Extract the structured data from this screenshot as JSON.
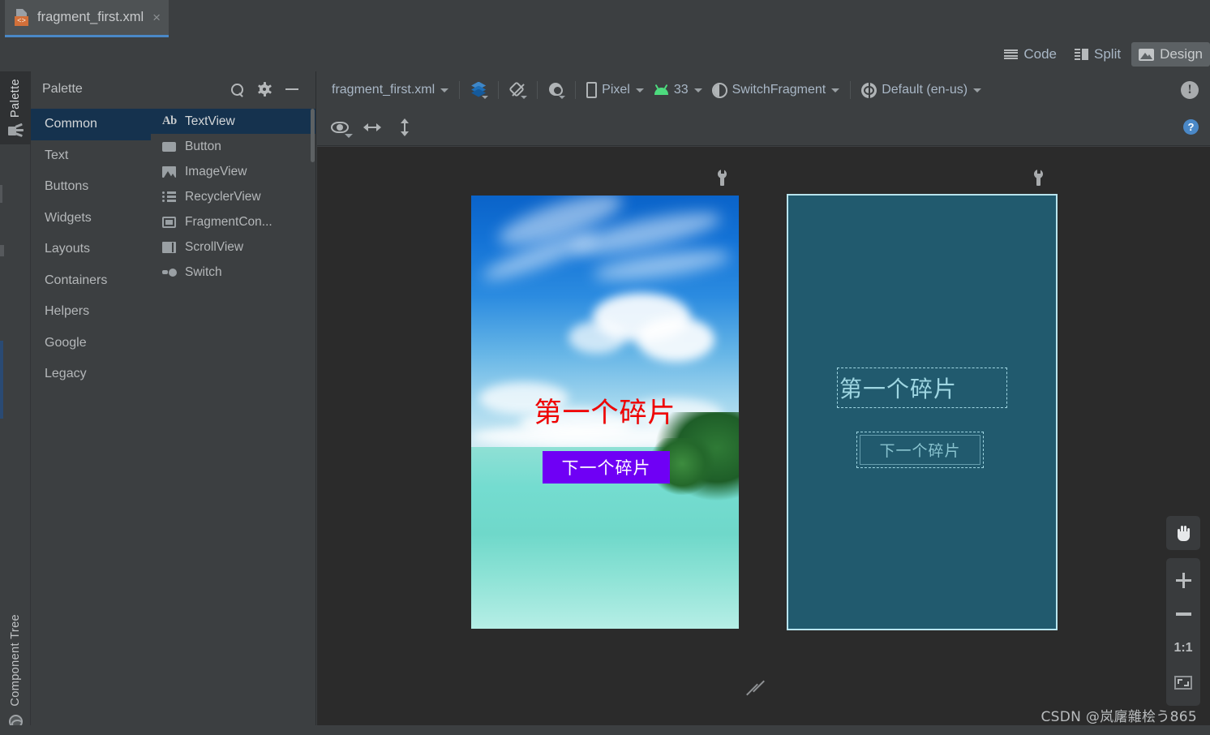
{
  "window": {
    "tab": {
      "label": "fragment_first.xml",
      "close": "×",
      "icon": "xml-file-icon",
      "code_glyph": "<>"
    }
  },
  "mode_switch": {
    "items": [
      {
        "label": "Code",
        "icon": "code-lines-icon",
        "active": false
      },
      {
        "label": "Split",
        "icon": "split-view-icon",
        "active": false
      },
      {
        "label": "Design",
        "icon": "design-image-icon",
        "active": true
      }
    ]
  },
  "left_strip": {
    "top_tab": {
      "label": "Palette",
      "icon": "palette-icon"
    },
    "bottom_tab": {
      "label": "Component Tree",
      "icon": "globe-icon"
    }
  },
  "palette": {
    "title": "Palette",
    "actions": [
      {
        "name": "search",
        "icon": "search-icon"
      },
      {
        "name": "settings",
        "icon": "gear-icon"
      },
      {
        "name": "collapse",
        "icon": "minus-icon"
      }
    ],
    "categories": [
      {
        "label": "Common",
        "selected": true
      },
      {
        "label": "Text",
        "selected": false
      },
      {
        "label": "Buttons",
        "selected": false
      },
      {
        "label": "Widgets",
        "selected": false
      },
      {
        "label": "Layouts",
        "selected": false
      },
      {
        "label": "Containers",
        "selected": false
      },
      {
        "label": "Helpers",
        "selected": false
      },
      {
        "label": "Google",
        "selected": false
      },
      {
        "label": "Legacy",
        "selected": false
      }
    ],
    "items": [
      {
        "label": "TextView",
        "icon": "ab-text-icon",
        "selected": true
      },
      {
        "label": "Button",
        "icon": "button-icon",
        "selected": false
      },
      {
        "label": "ImageView",
        "icon": "image-icon",
        "selected": false
      },
      {
        "label": "RecyclerView",
        "icon": "list-icon",
        "selected": false
      },
      {
        "label": "FragmentCon...",
        "icon": "fragment-container-icon",
        "selected": false
      },
      {
        "label": "ScrollView",
        "icon": "scrollview-icon",
        "selected": false
      },
      {
        "label": "Switch",
        "icon": "switch-icon",
        "selected": false
      }
    ]
  },
  "design_toolbar": {
    "file": "fragment_first.xml",
    "layout_variant_icon": "layers-icon",
    "orientation_icon": "rotate-device-icon",
    "theme_icon": "theme-contrast-icon",
    "device": "Pixel",
    "device_icon": "phone-icon",
    "api": "33",
    "api_icon": "android-icon",
    "theme": "SwitchFragment",
    "theme_sel_icon": "contrast-circle-icon",
    "locale": "Default (en-us)",
    "locale_icon": "globe-locale-icon",
    "issues_icon": "warning-icon"
  },
  "view_toolbar": {
    "visibility_icon": "eye-icon",
    "horizontal_icon": "horizontal-arrow-icon",
    "vertical_icon": "vertical-arrow-icon",
    "help_icon": "help-icon",
    "help_glyph": "?"
  },
  "canvas": {
    "design_preview": {
      "wrench_icon": "wrench-icon",
      "text_view": "第一个碎片",
      "button": "下一个碎片",
      "text_color": "#f10000",
      "button_bg": "#6f00f5",
      "button_color": "#ffffff"
    },
    "blueprint_preview": {
      "wrench_icon": "wrench-icon",
      "text_view": "第一个碎片",
      "button": "下一个碎片",
      "bg": "#215a6e",
      "stroke": "#9fd6e2"
    },
    "resize_handle_icon": "resize-diagonal-icon"
  },
  "zoom_controls": {
    "pan": {
      "label": "",
      "icon": "hand-icon"
    },
    "zoom_in": {
      "label": "",
      "icon": "plus-icon"
    },
    "zoom_out": {
      "label": "",
      "icon": "minus-icon"
    },
    "actual_size": {
      "label": "1:1",
      "icon": "one-to-one-icon"
    },
    "zoom_to_fit": {
      "label": "",
      "icon": "fit-screen-icon"
    }
  },
  "watermark": "CSDN @岚廜雜桧う865"
}
